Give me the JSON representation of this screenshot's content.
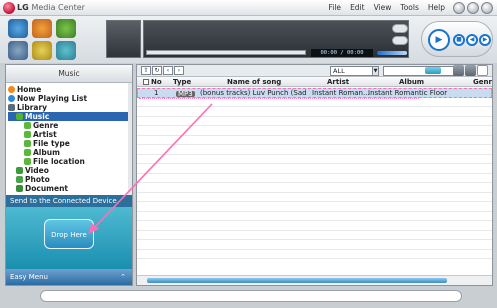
{
  "app": {
    "logo": "LG",
    "title_suffix": "Media Center"
  },
  "menu": [
    "File",
    "Edit",
    "View",
    "Tools",
    "Help"
  ],
  "player": {
    "timecode": "00:00 / 00:00"
  },
  "left_panel": {
    "header": "Music",
    "tree": [
      {
        "label": "Home",
        "icon": "home-icon",
        "indent": 0
      },
      {
        "label": "Now Playing List",
        "icon": "now-playing-icon",
        "indent": 0
      },
      {
        "label": "Library",
        "icon": "library-icon",
        "indent": 0
      },
      {
        "label": "Music",
        "icon": "music-icon",
        "indent": 1,
        "selected": true
      },
      {
        "label": "Genre",
        "icon": "genre-icon",
        "indent": 2
      },
      {
        "label": "Artist",
        "icon": "artist-icon",
        "indent": 2
      },
      {
        "label": "File type",
        "icon": "file-type-icon",
        "indent": 2
      },
      {
        "label": "Album",
        "icon": "album-icon",
        "indent": 2
      },
      {
        "label": "File location",
        "icon": "file-location-icon",
        "indent": 2
      },
      {
        "label": "Video",
        "icon": "video-icon",
        "indent": 1
      },
      {
        "label": "Photo",
        "icon": "photo-icon",
        "indent": 1
      },
      {
        "label": "Document",
        "icon": "document-icon",
        "indent": 1
      }
    ],
    "send_title": "Send to the Connected Device",
    "drop_label": "Drop Here",
    "easy_menu": "Easy Menu"
  },
  "toolbar": {
    "filter": "ALL"
  },
  "table": {
    "columns": [
      "No",
      "Type",
      "Name of song",
      "Artist",
      "Album",
      "Genre"
    ],
    "rows": [
      {
        "no": "1",
        "type": "MP3",
        "name": "(bonus tracks) Luv Punch (Sad",
        "artist": "Instant Roman...",
        "album": "Instant Romantic Floor",
        "genre": ""
      }
    ]
  },
  "colors": {
    "accent": "#2a67b0",
    "drag_arrow": "#ff6fb3"
  }
}
